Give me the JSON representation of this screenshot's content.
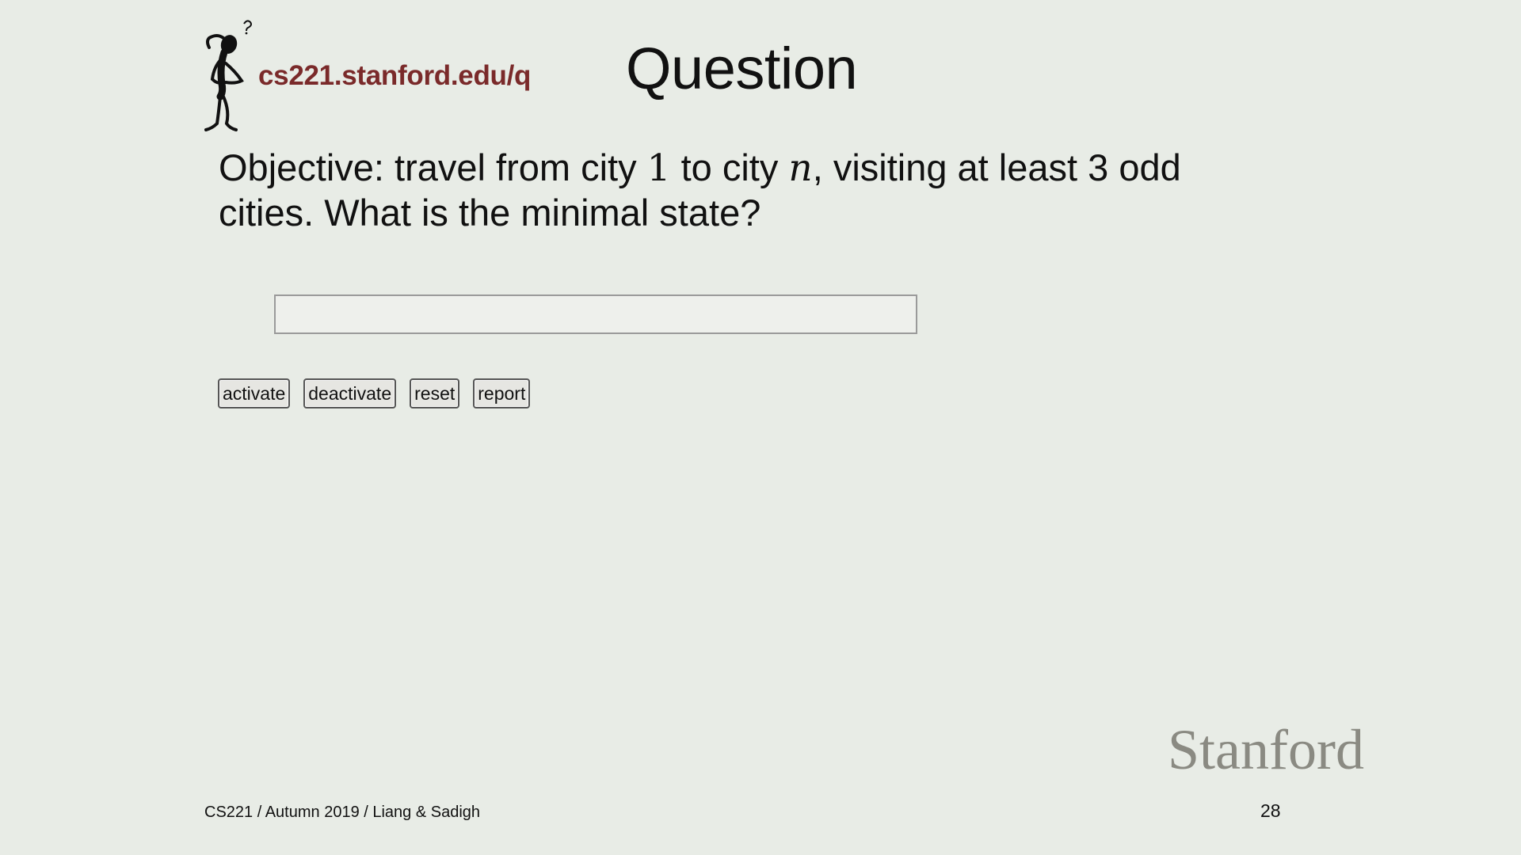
{
  "header": {
    "url": "cs221.stanford.edu/q",
    "title": "Question",
    "mascot_icon": "thinking-figure-icon"
  },
  "question": {
    "prefix": "Objective: travel from city ",
    "start_city": "1",
    "middle": " to city ",
    "end_city": "n",
    "suffix": ", visiting at least 3 odd cities. What is the minimal state?"
  },
  "answer": {
    "value": "",
    "placeholder": ""
  },
  "buttons": {
    "activate": "activate",
    "deactivate": "deactivate",
    "reset": "reset",
    "report": "report"
  },
  "footer": {
    "course": "CS221 / Autumn 2019 / Liang & Sadigh",
    "logo": "Stanford",
    "page_number": "28"
  },
  "colors": {
    "background": "#e8ece6",
    "url_color": "#7a2a2a",
    "logo_color": "#8a8a82"
  }
}
